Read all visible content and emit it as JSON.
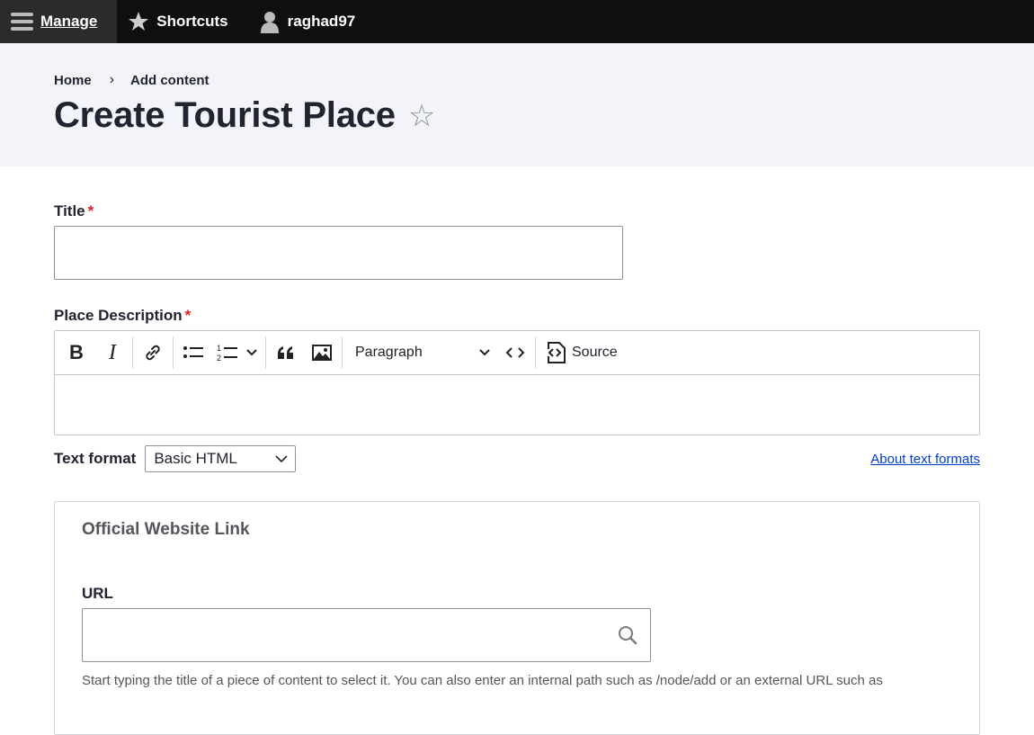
{
  "toolbar": {
    "manage": "Manage",
    "shortcuts": "Shortcuts",
    "user": "raghad97"
  },
  "breadcrumb": {
    "home": "Home",
    "sep": "›",
    "current": "Add content"
  },
  "page": {
    "title": "Create Tourist Place",
    "star": "☆"
  },
  "fields": {
    "title_label": "Title",
    "required_mark": "*",
    "description_label": "Place Description"
  },
  "editor": {
    "bold": "B",
    "italic": "I",
    "heading_select": "Paragraph",
    "source_label": "Source"
  },
  "text_format": {
    "label": "Text format",
    "value": "Basic HTML",
    "about_link": "About text formats"
  },
  "website": {
    "legend": "Official Website Link",
    "url_label": "URL",
    "description": "Start typing the title of a piece of content to select it. You can also enter an internal path such as /node/add or an external URL such as"
  }
}
